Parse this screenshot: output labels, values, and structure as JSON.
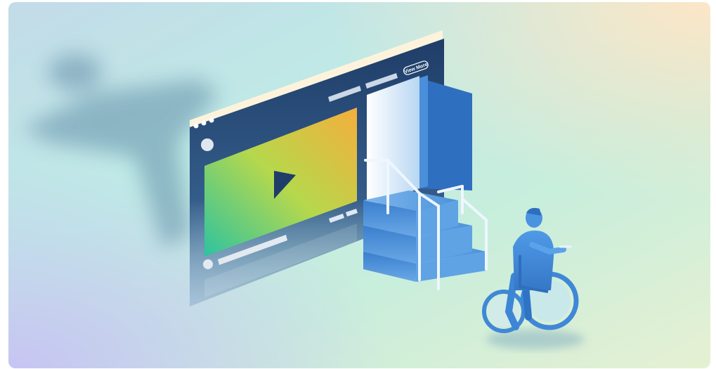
{
  "illustration": {
    "view_more_label": "View More",
    "colors": {
      "bg_top_left": "#bfe0ea",
      "bg_mid": "#b9ece2",
      "bg_top_right": "#fde8cc",
      "bg_bottom_left": "#c9c9f4",
      "browser_frame": "#1f3d68",
      "browser_topbar": "#fdf3dc",
      "accent_blue": "#3d8fe0",
      "video_gradient_start": "#2fc79a",
      "video_gradient_mid": "#b8d84a",
      "video_gradient_end": "#f4b23a"
    },
    "icons": [
      "play-icon",
      "wheelchair-user-figure",
      "staircase",
      "door"
    ]
  }
}
